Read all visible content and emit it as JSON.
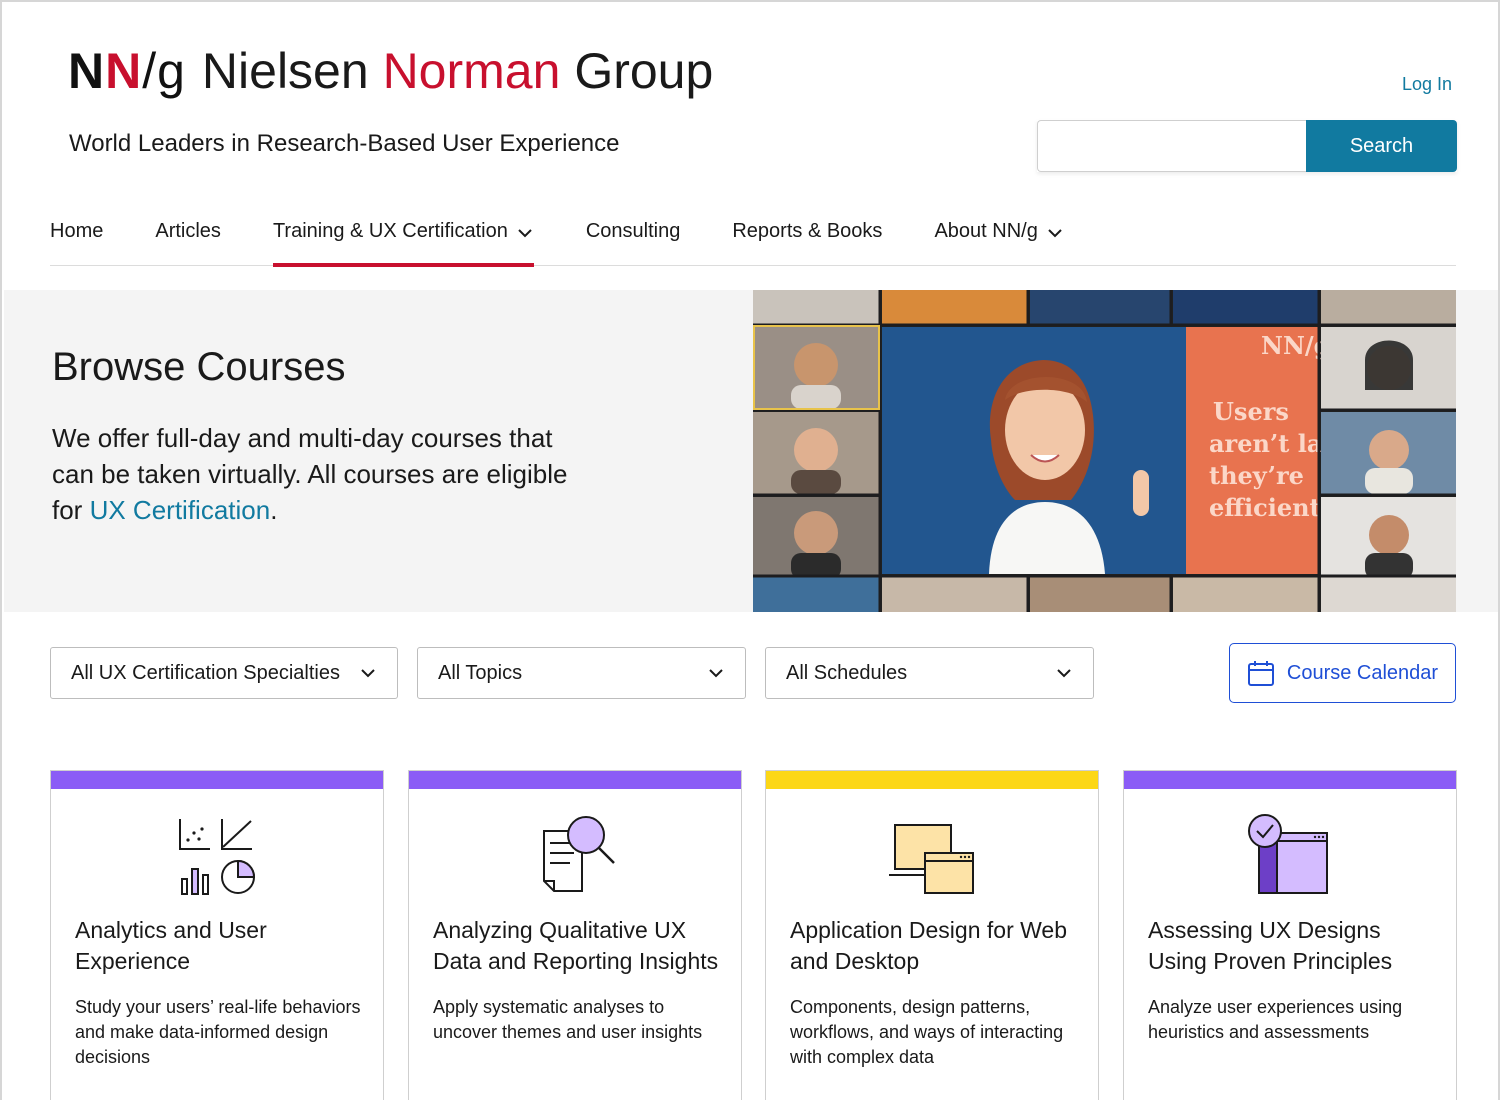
{
  "header": {
    "logo_n1": "N",
    "logo_n2": "N",
    "logo_slash": "/g",
    "logo_name_1": "Nielsen",
    "logo_name_2": "Norman",
    "logo_name_3": "Group",
    "tagline": "World Leaders in Research-Based User Experience",
    "login": "Log In",
    "search_value": "",
    "search_button": "Search"
  },
  "nav": {
    "items": [
      {
        "label": "Home",
        "has_dropdown": false
      },
      {
        "label": "Articles",
        "has_dropdown": false
      },
      {
        "label": "Training & UX Certification",
        "has_dropdown": true,
        "active": true
      },
      {
        "label": "Consulting",
        "has_dropdown": false
      },
      {
        "label": "Reports & Books",
        "has_dropdown": false
      },
      {
        "label": "About NN/g",
        "has_dropdown": true
      }
    ]
  },
  "hero": {
    "title": "Browse Courses",
    "text_1": "We offer full-day and multi-day courses that can be taken virtually. All courses are eligible for ",
    "link": "UX Certification",
    "text_2": ".",
    "poster_brand": "NN/g",
    "poster_l1": "Users",
    "poster_l2": "aren’t la",
    "poster_l3": "they’re",
    "poster_l4": "efficient"
  },
  "filters": {
    "specialties": "All UX Certification Specialties",
    "topics": "All Topics",
    "schedules": "All Schedules",
    "calendar": "Course Calendar"
  },
  "cards": [
    {
      "color": "#8b5cf6",
      "title": "Analytics and User Experience",
      "desc": "Study your users’ real-life behaviors and make data-informed design decisions"
    },
    {
      "color": "#8b5cf6",
      "title": "Analyzing Qualitative UX Data and Reporting Insights",
      "desc": "Apply systematic analyses to uncover themes and user insights"
    },
    {
      "color": "#fcd716",
      "title": "Application Design for Web and Desktop",
      "desc": "Components, design patterns, workflows, and ways of interacting with complex data"
    },
    {
      "color": "#8b5cf6",
      "title": "Assessing UX Designs Using Proven Principles",
      "desc": "Analyze user experiences using heuristics and assessments"
    }
  ],
  "colors": {
    "brand_red": "#c8102e",
    "link_teal": "#117aa0",
    "calendar_blue": "#1f4fd6",
    "card_purple": "#8b5cf6",
    "card_yellow": "#fcd716",
    "icon_purple_light": "#d4bcff",
    "icon_yellow_light": "#fde3a7"
  }
}
